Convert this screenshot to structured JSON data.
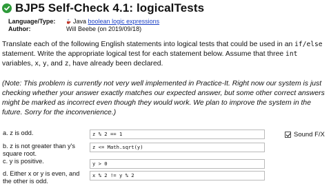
{
  "header": {
    "title": "BJP5 Self-Check 4.1: logicalTests"
  },
  "meta": {
    "language_label": "Language/Type:",
    "language_prefix": "Java",
    "language_links": "boolean logic expressions",
    "author_label": "Author:",
    "author_value": "Will Beebe (on 2019/09/18)"
  },
  "instructions": {
    "part1": "Translate each of the following English statements into logical tests that could be used in an ",
    "code_ifelse": "if/else",
    "part2": " statement. Write the appropriate logical test for each statement below. Assume that three ",
    "code_int": "int",
    "part3": " variables, ",
    "code_x": "x",
    "part4": ", ",
    "code_y": "y",
    "part5": ", and ",
    "code_z": "z",
    "part6": ", have already been declared."
  },
  "note": "(Note: This problem is currently not very well implemented in Practice-It. Right now our system is just checking whether your answer exactly matches our expected answer, but some other correct answers might be marked as incorrect even though they would work. We plan to improve the system in the future. Sorry for the inconvenience.)",
  "questions": [
    {
      "label": "a. z is odd.",
      "answer": "z % 2 == 1"
    },
    {
      "label": "b. z is not greater than y's square root.",
      "answer": "z <= Math.sqrt(y)"
    },
    {
      "label": "c. y is positive.",
      "answer": "y > 0"
    },
    {
      "label": "d. Either x or y is even, and the other is odd.",
      "answer": "x % 2 != y % 2"
    }
  ],
  "sound": {
    "label": "Sound F/X",
    "checked": true
  },
  "colors": {
    "success_green": "#2e9b3a",
    "link_blue": "#1a3fc4"
  }
}
